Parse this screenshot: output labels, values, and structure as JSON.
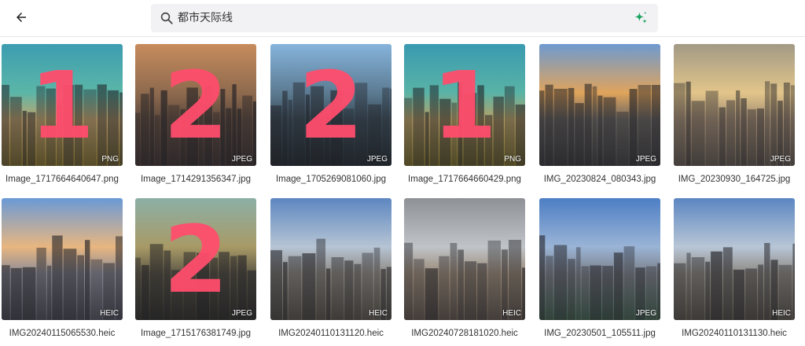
{
  "search": {
    "query": "都市天际线"
  },
  "gallery": {
    "items": [
      {
        "filename": "Image_1717664640647.png",
        "type": "PNG",
        "mark": "1",
        "colors": [
          "#3d9db0",
          "#5bb6a8",
          "#c2a36c",
          "#7b6a2c"
        ]
      },
      {
        "filename": "Image_1714291356347.jpg",
        "type": "JPEG",
        "mark": "2",
        "colors": [
          "#c78c5d",
          "#8e6a4e",
          "#5e4a3e",
          "#3a3030"
        ]
      },
      {
        "filename": "Image_1705269081060.jpg",
        "type": "JPEG",
        "mark": "2",
        "colors": [
          "#86b4dc",
          "#5c7b92",
          "#3a4a56",
          "#22292f"
        ]
      },
      {
        "filename": "Image_1717664660429.png",
        "type": "PNG",
        "mark": "1",
        "colors": [
          "#3a9ab0",
          "#59b3a6",
          "#b8a065",
          "#6f6429"
        ]
      },
      {
        "filename": "IMG_20230824_080343.jpg",
        "type": "JPEG",
        "mark": "",
        "colors": [
          "#6e9ad0",
          "#e0a45c",
          "#6b6762",
          "#3c3c3e"
        ]
      },
      {
        "filename": "IMG_20230930_164725.jpg",
        "type": "JPEG",
        "mark": "",
        "colors": [
          "#a29a86",
          "#e2c58a",
          "#a08a72",
          "#5c544c"
        ]
      },
      {
        "filename": "IMG20240115065530.heic",
        "type": "HEIC",
        "mark": "",
        "colors": [
          "#6a9ad6",
          "#e8b680",
          "#8b8c98",
          "#4d4e58"
        ]
      },
      {
        "filename": "Image_1715176381749.jpg",
        "type": "JPEG",
        "mark": "2",
        "colors": [
          "#8cb0a6",
          "#a89a66",
          "#5e5848",
          "#2f2e2a"
        ]
      },
      {
        "filename": "IMG20240110131120.heic",
        "type": "HEIC",
        "mark": "",
        "colors": [
          "#5d86c0",
          "#b6c4d4",
          "#8f8a82",
          "#565048"
        ]
      },
      {
        "filename": "IMG20240728181020.heic",
        "type": "HEIC",
        "mark": "",
        "colors": [
          "#8e9296",
          "#c0c4c8",
          "#9a8a78",
          "#5a5048"
        ]
      },
      {
        "filename": "IMG_20230501_105511.jpg",
        "type": "JPEG",
        "mark": "",
        "colors": [
          "#4d7ec4",
          "#9ab4d6",
          "#7c8088",
          "#3e5a4a"
        ]
      },
      {
        "filename": "IMG20240110131130.heic",
        "type": "HEIC",
        "mark": "",
        "colors": [
          "#5c86c2",
          "#b8c6d6",
          "#8e8982",
          "#555047"
        ]
      }
    ]
  }
}
